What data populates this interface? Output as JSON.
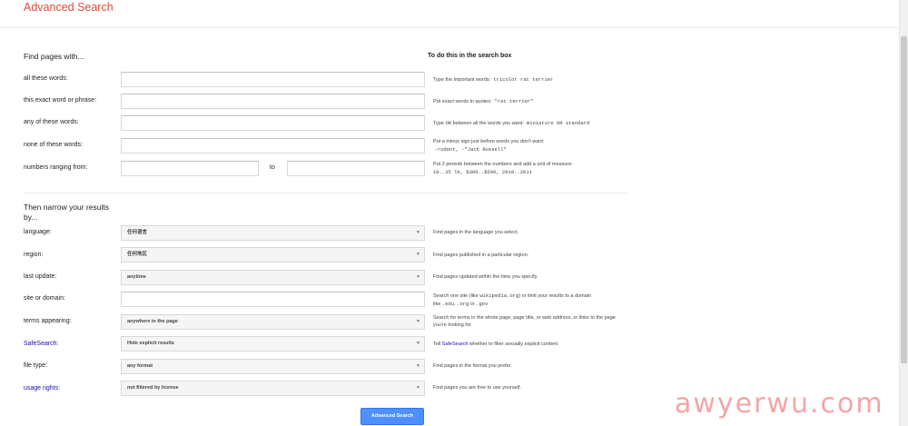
{
  "header": {
    "title": "Advanced Search"
  },
  "find_section": {
    "title": "Find pages with...",
    "column_heading": "To do this in the search box",
    "rows": [
      {
        "label": "all these words:",
        "value": "",
        "hint": "Type the important words:",
        "hint_code": "tricolor rat terrier"
      },
      {
        "label": "this exact word or phrase:",
        "value": "",
        "hint": "Put exact words in quotes:",
        "hint_code": "\"rat terrier\""
      },
      {
        "label": "any of these words:",
        "value": "",
        "hint_pre": "Type ",
        "hint_code_inline": "OR",
        "hint": " between all the words you want:",
        "hint_code": "miniature OR standard"
      },
      {
        "label": "none of these words:",
        "value": "",
        "hint": "Put a minus sign just before words you don't want:",
        "hint_code": "-rodent, -\"Jack Russell\""
      },
      {
        "label": "numbers ranging from:",
        "from_value": "",
        "to_label": "to",
        "to_value": "",
        "hint": "Put 2 periods between the numbers and add a unit of measure:",
        "hint_code": "10..35 lb, $300..$500, 2010..2011"
      }
    ]
  },
  "narrow_section": {
    "title_line1": "Then narrow your results",
    "title_line2": "by...",
    "rows": [
      {
        "label": "language:",
        "value": "任何语言",
        "hint": "Find pages in the language you select."
      },
      {
        "label": "region:",
        "value": "任何地区",
        "hint": "Find pages published in a particular region."
      },
      {
        "label": "last update:",
        "value": "anytime",
        "hint": "Find pages updated within the time you specify."
      },
      {
        "label": "site or domain:",
        "value": "",
        "hint_a": "Search one site (like ",
        "hint_code_a": "wikipedia.org",
        "hint_b": ") or limit your results to a domain",
        "hint_c": "like ",
        "hint_code_b": ".edu",
        "hint_d": ", ",
        "hint_code_c": ".org",
        "hint_e": " or ",
        "hint_code_d": ".gov"
      },
      {
        "label": "terms appearing:",
        "value": "anywhere in the page",
        "hint": "Search for terms in the whole page, page title, or web address, or links to the page you're looking for."
      },
      {
        "label": "SafeSearch:",
        "value": "Hide explicit results",
        "hint_pre": "Tell ",
        "hint_link": "SafeSearch",
        "hint": " whether to filter sexually explicit content."
      },
      {
        "label": "file type:",
        "value": "any format",
        "hint": "Find pages in the format you prefer."
      },
      {
        "label": "usage rights:",
        "value": "not filtered by license",
        "hint": "Find pages you are free to use yourself."
      }
    ]
  },
  "submit_label": "Advanced Search",
  "watermark": "awyerwu.com",
  "icons": {
    "dropdown": "caret-down-icon"
  },
  "colors": {
    "title": "#dd4b39",
    "link": "#1a0dab",
    "button": "#4d90fe"
  }
}
